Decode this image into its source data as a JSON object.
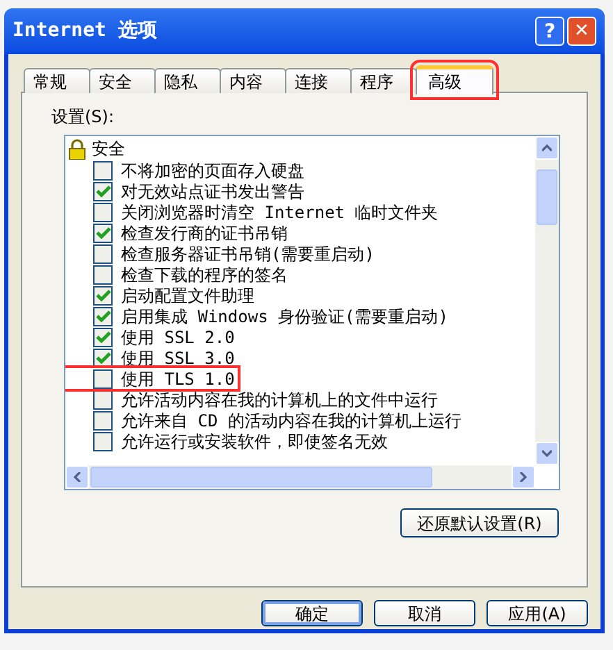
{
  "window": {
    "title": "Internet 选项",
    "help_button": "?",
    "close_button": "✕"
  },
  "tabs": [
    {
      "label": "常规",
      "selected": false,
      "highlighted": false
    },
    {
      "label": "安全",
      "selected": false,
      "highlighted": false
    },
    {
      "label": "隐私",
      "selected": false,
      "highlighted": false
    },
    {
      "label": "内容",
      "selected": false,
      "highlighted": false
    },
    {
      "label": "连接",
      "selected": false,
      "highlighted": false
    },
    {
      "label": "程序",
      "selected": false,
      "highlighted": false
    },
    {
      "label": "高级",
      "selected": true,
      "highlighted": true
    }
  ],
  "settings_label": "设置(S):",
  "settings": {
    "group": "安全",
    "items": [
      {
        "label": "不将加密的页面存入硬盘",
        "checked": false,
        "highlighted": false
      },
      {
        "label": "对无效站点证书发出警告",
        "checked": true,
        "highlighted": false
      },
      {
        "label": "关闭浏览器时清空 Internet 临时文件夹",
        "checked": false,
        "highlighted": false
      },
      {
        "label": "检查发行商的证书吊销",
        "checked": true,
        "highlighted": false
      },
      {
        "label": "检查服务器证书吊销(需要重启动)",
        "checked": false,
        "highlighted": false
      },
      {
        "label": "检查下载的程序的签名",
        "checked": false,
        "highlighted": false
      },
      {
        "label": "启动配置文件助理",
        "checked": true,
        "highlighted": false
      },
      {
        "label": "启用集成 Windows 身份验证(需要重启动)",
        "checked": true,
        "highlighted": false
      },
      {
        "label": "使用 SSL 2.0",
        "checked": true,
        "highlighted": false
      },
      {
        "label": "使用 SSL 3.0",
        "checked": true,
        "highlighted": false
      },
      {
        "label": "使用 TLS 1.0",
        "checked": false,
        "highlighted": true
      },
      {
        "label": "允许活动内容在我的计算机上的文件中运行",
        "checked": false,
        "highlighted": false
      },
      {
        "label": "允许来自 CD 的活动内容在我的计算机上运行",
        "checked": false,
        "highlighted": false
      },
      {
        "label": "允许运行或安装软件，即使签名无效",
        "checked": false,
        "highlighted": false
      }
    ]
  },
  "restore_button": "还原默认设置(R)",
  "buttons": [
    {
      "label": "确定",
      "default": true
    },
    {
      "label": "取消",
      "default": false
    },
    {
      "label": "应用(A)",
      "default": false
    }
  ]
}
